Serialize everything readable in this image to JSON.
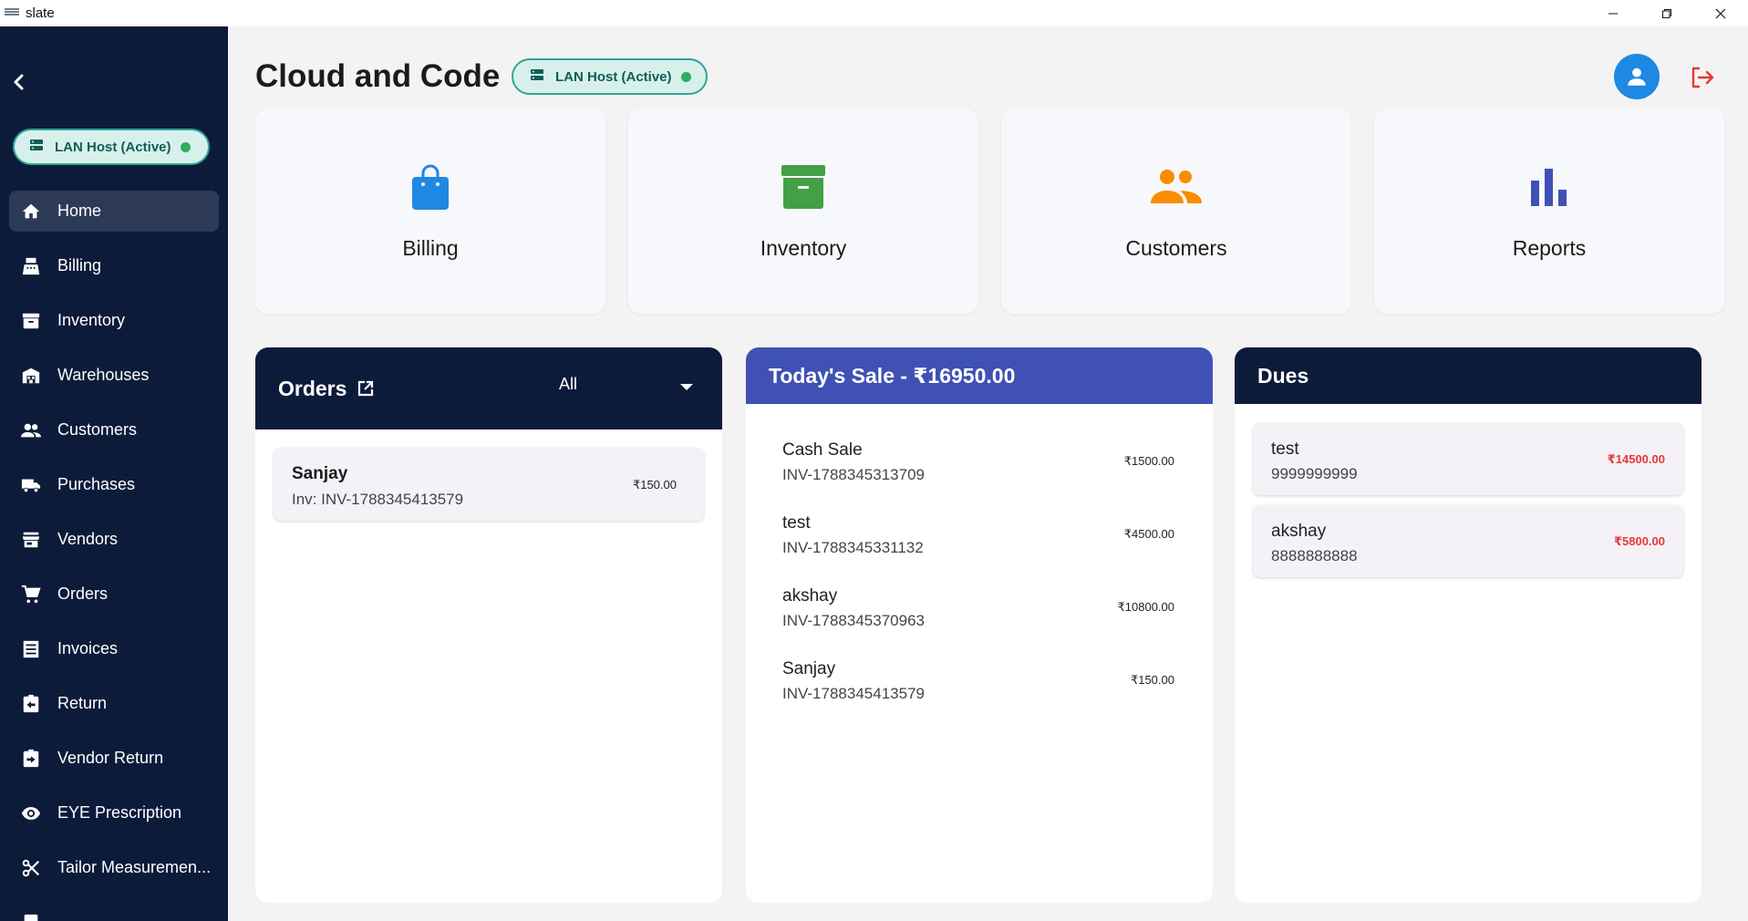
{
  "window": {
    "title": "slate"
  },
  "sidebar": {
    "server_badge": "LAN Host (Active)",
    "items": [
      {
        "label": "Home",
        "icon": "home-icon"
      },
      {
        "label": "Billing",
        "icon": "register-icon"
      },
      {
        "label": "Inventory",
        "icon": "archive-icon"
      },
      {
        "label": "Warehouses",
        "icon": "warehouse-icon"
      },
      {
        "label": "Customers",
        "icon": "people-icon"
      },
      {
        "label": "Purchases",
        "icon": "truck-icon"
      },
      {
        "label": "Vendors",
        "icon": "store-icon"
      },
      {
        "label": "Orders",
        "icon": "cart-icon"
      },
      {
        "label": "Invoices",
        "icon": "list-icon"
      },
      {
        "label": "Return",
        "icon": "return-icon"
      },
      {
        "label": "Vendor Return",
        "icon": "vendor-return-icon"
      },
      {
        "label": "EYE Prescription",
        "icon": "eye-icon"
      },
      {
        "label": "Tailor Measuremen...",
        "icon": "scissors-icon"
      }
    ]
  },
  "header": {
    "title": "Cloud and Code",
    "server_badge": "LAN Host (Active)"
  },
  "tiles": [
    {
      "label": "Billing",
      "icon": "shopping-bag-icon",
      "color": "#1e88e5"
    },
    {
      "label": "Inventory",
      "icon": "archive-box-icon",
      "color": "#43a047"
    },
    {
      "label": "Customers",
      "icon": "people-icon",
      "color": "#fb8c00"
    },
    {
      "label": "Reports",
      "icon": "bar-chart-icon",
      "color": "#3f51b5"
    }
  ],
  "orders": {
    "title": "Orders",
    "filter": "All",
    "items": [
      {
        "name": "Sanjay",
        "invoice": "Inv: INV-1788345413579",
        "amount": "₹150.00"
      }
    ]
  },
  "todays_sale": {
    "title": "Today's Sale - ₹16950.00",
    "items": [
      {
        "name": "Cash Sale",
        "invoice": "INV-1788345313709",
        "amount": "₹1500.00"
      },
      {
        "name": "test",
        "invoice": "INV-1788345331132",
        "amount": "₹4500.00"
      },
      {
        "name": "akshay",
        "invoice": "INV-1788345370963",
        "amount": "₹10800.00"
      },
      {
        "name": "Sanjay",
        "invoice": "INV-1788345413579",
        "amount": "₹150.00"
      }
    ]
  },
  "dues": {
    "title": "Dues",
    "items": [
      {
        "name": "test",
        "phone": "9999999999",
        "amount": "₹14500.00"
      },
      {
        "name": "akshay",
        "phone": "8888888888",
        "amount": "₹5800.00"
      }
    ]
  },
  "colors": {
    "sidebar_bg": "#0d1b3b",
    "accent_blue": "#3f51b5",
    "badge_green": "#2fa597",
    "due_red": "#e53935"
  }
}
